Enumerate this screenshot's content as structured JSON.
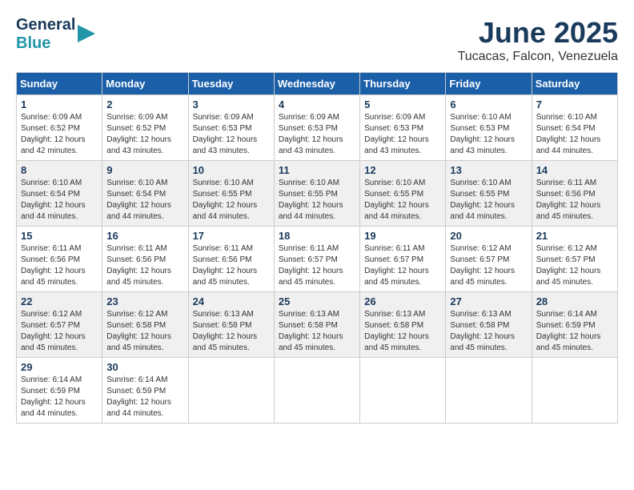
{
  "header": {
    "logo_line1": "General",
    "logo_line2": "Blue",
    "month": "June 2025",
    "location": "Tucacas, Falcon, Venezuela"
  },
  "days_of_week": [
    "Sunday",
    "Monday",
    "Tuesday",
    "Wednesday",
    "Thursday",
    "Friday",
    "Saturday"
  ],
  "weeks": [
    [
      {
        "day": "1",
        "info": "Sunrise: 6:09 AM\nSunset: 6:52 PM\nDaylight: 12 hours\nand 42 minutes."
      },
      {
        "day": "2",
        "info": "Sunrise: 6:09 AM\nSunset: 6:52 PM\nDaylight: 12 hours\nand 43 minutes."
      },
      {
        "day": "3",
        "info": "Sunrise: 6:09 AM\nSunset: 6:53 PM\nDaylight: 12 hours\nand 43 minutes."
      },
      {
        "day": "4",
        "info": "Sunrise: 6:09 AM\nSunset: 6:53 PM\nDaylight: 12 hours\nand 43 minutes."
      },
      {
        "day": "5",
        "info": "Sunrise: 6:09 AM\nSunset: 6:53 PM\nDaylight: 12 hours\nand 43 minutes."
      },
      {
        "day": "6",
        "info": "Sunrise: 6:10 AM\nSunset: 6:53 PM\nDaylight: 12 hours\nand 43 minutes."
      },
      {
        "day": "7",
        "info": "Sunrise: 6:10 AM\nSunset: 6:54 PM\nDaylight: 12 hours\nand 44 minutes."
      }
    ],
    [
      {
        "day": "8",
        "info": "Sunrise: 6:10 AM\nSunset: 6:54 PM\nDaylight: 12 hours\nand 44 minutes."
      },
      {
        "day": "9",
        "info": "Sunrise: 6:10 AM\nSunset: 6:54 PM\nDaylight: 12 hours\nand 44 minutes."
      },
      {
        "day": "10",
        "info": "Sunrise: 6:10 AM\nSunset: 6:55 PM\nDaylight: 12 hours\nand 44 minutes."
      },
      {
        "day": "11",
        "info": "Sunrise: 6:10 AM\nSunset: 6:55 PM\nDaylight: 12 hours\nand 44 minutes."
      },
      {
        "day": "12",
        "info": "Sunrise: 6:10 AM\nSunset: 6:55 PM\nDaylight: 12 hours\nand 44 minutes."
      },
      {
        "day": "13",
        "info": "Sunrise: 6:10 AM\nSunset: 6:55 PM\nDaylight: 12 hours\nand 44 minutes."
      },
      {
        "day": "14",
        "info": "Sunrise: 6:11 AM\nSunset: 6:56 PM\nDaylight: 12 hours\nand 45 minutes."
      }
    ],
    [
      {
        "day": "15",
        "info": "Sunrise: 6:11 AM\nSunset: 6:56 PM\nDaylight: 12 hours\nand 45 minutes."
      },
      {
        "day": "16",
        "info": "Sunrise: 6:11 AM\nSunset: 6:56 PM\nDaylight: 12 hours\nand 45 minutes."
      },
      {
        "day": "17",
        "info": "Sunrise: 6:11 AM\nSunset: 6:56 PM\nDaylight: 12 hours\nand 45 minutes."
      },
      {
        "day": "18",
        "info": "Sunrise: 6:11 AM\nSunset: 6:57 PM\nDaylight: 12 hours\nand 45 minutes."
      },
      {
        "day": "19",
        "info": "Sunrise: 6:11 AM\nSunset: 6:57 PM\nDaylight: 12 hours\nand 45 minutes."
      },
      {
        "day": "20",
        "info": "Sunrise: 6:12 AM\nSunset: 6:57 PM\nDaylight: 12 hours\nand 45 minutes."
      },
      {
        "day": "21",
        "info": "Sunrise: 6:12 AM\nSunset: 6:57 PM\nDaylight: 12 hours\nand 45 minutes."
      }
    ],
    [
      {
        "day": "22",
        "info": "Sunrise: 6:12 AM\nSunset: 6:57 PM\nDaylight: 12 hours\nand 45 minutes."
      },
      {
        "day": "23",
        "info": "Sunrise: 6:12 AM\nSunset: 6:58 PM\nDaylight: 12 hours\nand 45 minutes."
      },
      {
        "day": "24",
        "info": "Sunrise: 6:13 AM\nSunset: 6:58 PM\nDaylight: 12 hours\nand 45 minutes."
      },
      {
        "day": "25",
        "info": "Sunrise: 6:13 AM\nSunset: 6:58 PM\nDaylight: 12 hours\nand 45 minutes."
      },
      {
        "day": "26",
        "info": "Sunrise: 6:13 AM\nSunset: 6:58 PM\nDaylight: 12 hours\nand 45 minutes."
      },
      {
        "day": "27",
        "info": "Sunrise: 6:13 AM\nSunset: 6:58 PM\nDaylight: 12 hours\nand 45 minutes."
      },
      {
        "day": "28",
        "info": "Sunrise: 6:14 AM\nSunset: 6:59 PM\nDaylight: 12 hours\nand 45 minutes."
      }
    ],
    [
      {
        "day": "29",
        "info": "Sunrise: 6:14 AM\nSunset: 6:59 PM\nDaylight: 12 hours\nand 44 minutes."
      },
      {
        "day": "30",
        "info": "Sunrise: 6:14 AM\nSunset: 6:59 PM\nDaylight: 12 hours\nand 44 minutes."
      },
      {
        "day": "",
        "info": ""
      },
      {
        "day": "",
        "info": ""
      },
      {
        "day": "",
        "info": ""
      },
      {
        "day": "",
        "info": ""
      },
      {
        "day": "",
        "info": ""
      }
    ]
  ]
}
